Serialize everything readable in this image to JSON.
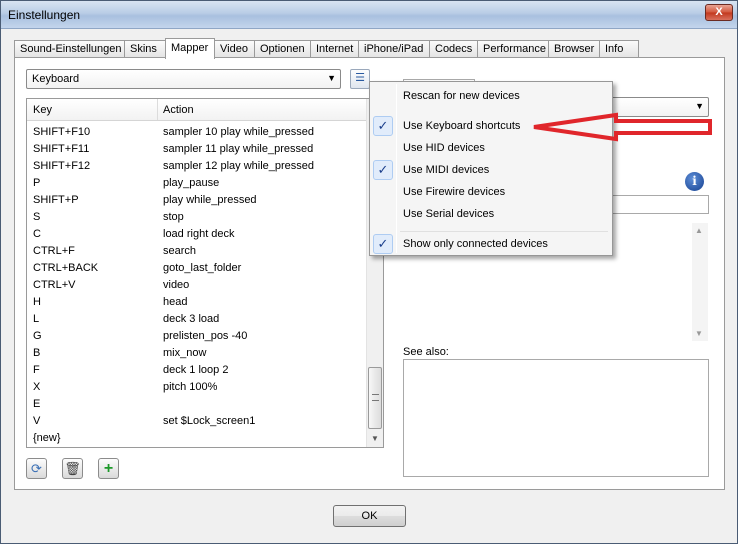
{
  "window": {
    "title": "Einstellungen",
    "close_glyph": "X"
  },
  "tabs": [
    {
      "label": "Sound-Einstellungen"
    },
    {
      "label": "Skins"
    },
    {
      "label": "Mapper"
    },
    {
      "label": "Video"
    },
    {
      "label": "Optionen"
    },
    {
      "label": "Internet"
    },
    {
      "label": "iPhone/iPad"
    },
    {
      "label": "Codecs"
    },
    {
      "label": "Performance"
    },
    {
      "label": "Browser"
    },
    {
      "label": "Info"
    }
  ],
  "mapper": {
    "device_select": "Keyboard",
    "columns": {
      "key": "Key",
      "action": "Action"
    },
    "rows": [
      {
        "key": "SHIFT+F10",
        "action": "sampler 10 play while_pressed"
      },
      {
        "key": "SHIFT+F11",
        "action": "sampler 11 play while_pressed"
      },
      {
        "key": "SHIFT+F12",
        "action": "sampler 12 play while_pressed"
      },
      {
        "key": "P",
        "action": "play_pause"
      },
      {
        "key": "SHIFT+P",
        "action": "play while_pressed"
      },
      {
        "key": "S",
        "action": "stop"
      },
      {
        "key": "C",
        "action": "load right deck"
      },
      {
        "key": "CTRL+F",
        "action": "search"
      },
      {
        "key": "CTRL+BACK",
        "action": "goto_last_folder"
      },
      {
        "key": "CTRL+V",
        "action": "video"
      },
      {
        "key": "H",
        "action": "head"
      },
      {
        "key": "L",
        "action": "deck 3 load"
      },
      {
        "key": "G",
        "action": "prelisten_pos -40"
      },
      {
        "key": "B",
        "action": "mix_now"
      },
      {
        "key": "F",
        "action": "deck 1 loop 2"
      },
      {
        "key": "X",
        "action": "pitch 100%"
      },
      {
        "key": "E",
        "action": ""
      },
      {
        "key": "V",
        "action": "set $Lock_screen1"
      },
      {
        "key": "{new}",
        "action": ""
      }
    ],
    "see_also_label": "See also:",
    "toolbar_icons": [
      "refresh-icon",
      "trash-icon",
      "add-icon"
    ]
  },
  "menu": {
    "items": [
      {
        "label": "Rescan for new devices",
        "checked": false
      },
      {
        "label": "Use Keyboard shortcuts",
        "checked": true
      },
      {
        "label": "Use HID devices",
        "checked": false
      },
      {
        "label": "Use MIDI devices",
        "checked": true
      },
      {
        "label": "Use Firewire devices",
        "checked": false
      },
      {
        "label": "Use Serial devices",
        "checked": false
      },
      {
        "label": "Show only connected devices",
        "checked": true
      }
    ],
    "check_glyph": "✓"
  },
  "annotation": {
    "arrow_color": "#e0262b"
  },
  "footer": {
    "ok_label": "OK"
  }
}
